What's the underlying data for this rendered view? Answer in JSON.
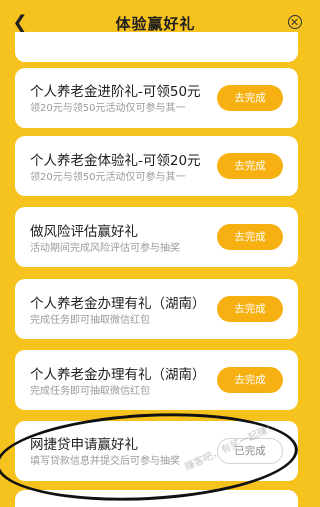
{
  "header": {
    "back_icon": "chevron-left-icon",
    "title": "体验赢好礼",
    "close_icon": "close-circle-icon"
  },
  "tasks": [
    {
      "title": "",
      "subtitle": "",
      "button": ""
    },
    {
      "title": "个人养老金进阶礼-可领50元",
      "subtitle": "领20元与领50元活动仅可参与其一",
      "button": "去完成"
    },
    {
      "title": "个人养老金体验礼-可领20元",
      "subtitle": "领20元与领50元活动仅可参与其一",
      "button": "去完成"
    },
    {
      "title": "做风险评估赢好礼",
      "subtitle": "活动期间完成风险评估可参与抽奖",
      "button": "去完成"
    },
    {
      "title": "个人养老金办理有礼（湖南）",
      "subtitle": "完成任务即可抽取微信红包",
      "button": "去完成"
    },
    {
      "title": "个人养老金办理有礼（湖南）",
      "subtitle": "完成任务即可抽取微信红包",
      "button": "去完成"
    },
    {
      "title": "网捷贷申请赢好礼",
      "subtitle": "填写贷款信息并提交后可参与抽奖",
      "button": "已完成"
    }
  ],
  "watermark": "赚客吧，有奖一起赚！",
  "colors": {
    "background": "#f6c21d",
    "button": "#f6b012",
    "card": "#ffffff"
  }
}
